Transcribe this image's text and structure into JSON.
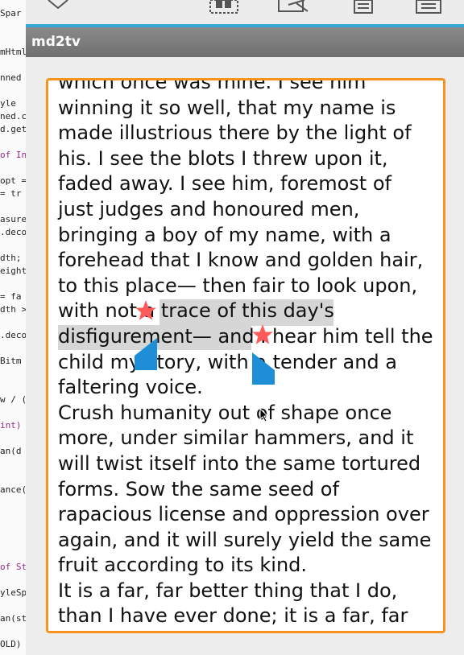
{
  "code_background": {
    "lines": [
      {
        "text": "Spar",
        "kw": false
      },
      {
        "text": "mHtml",
        "kw": false
      },
      {
        "text": "nned",
        "kw": false
      },
      {
        "text": "yle",
        "kw": false
      },
      {
        "text": "ned.c",
        "kw": false
      },
      {
        "text": "d.get",
        "kw": false
      },
      {
        "text": "of In",
        "kw": true
      },
      {
        "text": "opt =",
        "kw": false
      },
      {
        "text": " = tr",
        "kw": false
      },
      {
        "text": "asure",
        "kw": false
      },
      {
        "text": ".deco",
        "kw": false
      },
      {
        "text": "dth;",
        "kw": false
      },
      {
        "text": "eight",
        "kw": false
      },
      {
        "text": " = fa",
        "kw": false
      },
      {
        "text": "dth >",
        "kw": false
      },
      {
        "text": ".deco",
        "kw": false
      },
      {
        "text": " Bitm",
        "kw": false
      },
      {
        "text": "w / (",
        "kw": false
      },
      {
        "text": "int)",
        "kw": true
      },
      {
        "text": "an(d",
        "kw": false
      },
      {
        "text": "ance(",
        "kw": false
      },
      {
        "text": "of St",
        "kw": true
      },
      {
        "text": "yleSp",
        "kw": false
      },
      {
        "text": "an(st",
        "kw": false
      },
      {
        "text": "OLD)",
        "kw": false
      }
    ]
  },
  "toolbar": {
    "icons": [
      "close-icon",
      "select-all-icon",
      "cut-icon",
      "copy-icon",
      "paste-icon"
    ],
    "accent_color": "#36a9d9"
  },
  "title_bar": {
    "title": "md2tv"
  },
  "text_view": {
    "border_color": "#f7931e",
    "lines": [
      "which once was mine. I see him",
      "winning it so well, that my name is",
      "made illustrious there by the light of",
      "his. I see the blots I threw upon it,",
      "faded away. I see him, foremost of",
      "just judges and honoured men,",
      "bringing a boy of my name, with a",
      "forehead that I know and golden hair,",
      "to this place— then fair to look upon,",
      "with not a trace of this day's",
      "disfigurement— and I hear him tell the",
      "child my story, with a tender and a",
      "faltering voice.",
      "Crush humanity out of shape once",
      "more, under similar hammers, and it",
      "will twist itself into the same tortured",
      "forms. Sow the same seed of",
      "rapacious license and oppression over",
      "again, and it will surely yield the same",
      "fruit according to its kind.",
      "It is a far, far better thing that I do,",
      "than I have ever done; it is a far, far"
    ],
    "selection_color": "#d6d6d6",
    "handle_color": "#1e8fd6",
    "star_color": "#ff5a5a"
  }
}
